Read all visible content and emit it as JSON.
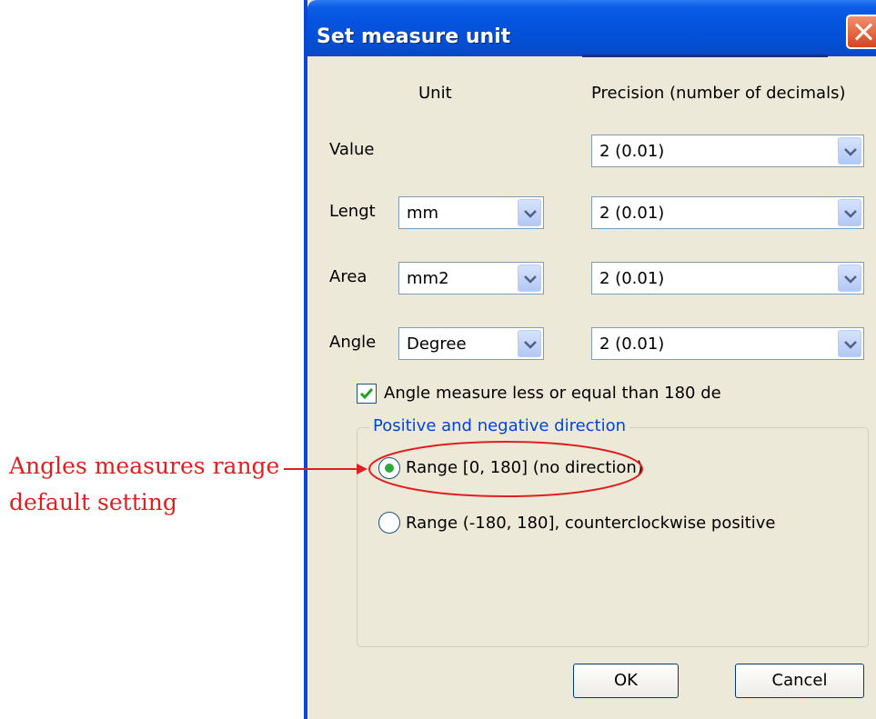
{
  "dialog": {
    "title": "Set measure unit",
    "headers": {
      "unit": "Unit",
      "precision": "Precision (number of decimals)"
    },
    "rows": [
      {
        "label": "Value",
        "unit": null,
        "precision": "2 (0.01)"
      },
      {
        "label": "Lengt",
        "unit": "mm",
        "precision": "2 (0.01)"
      },
      {
        "label": "Area",
        "unit": "mm2",
        "precision": "2 (0.01)"
      },
      {
        "label": "Angle",
        "unit": "Degree",
        "precision": "2 (0.01)"
      }
    ],
    "checkbox": {
      "label": "Angle measure less or equal than 180 de",
      "checked": true
    },
    "direction_group": {
      "legend": "Positive and negative direction",
      "options": [
        {
          "label": "Range [0, 180] (no direction)",
          "selected": true
        },
        {
          "label": "Range (-180, 180], counterclockwise positive",
          "selected": false
        }
      ]
    },
    "buttons": {
      "ok": "OK",
      "cancel": "Cancel"
    }
  },
  "annotation": {
    "line1": "Angles measures range",
    "line2": "default setting",
    "color": "#e02020"
  },
  "icons": [
    "close-icon",
    "chevron-down-icon",
    "checkmark-icon"
  ]
}
